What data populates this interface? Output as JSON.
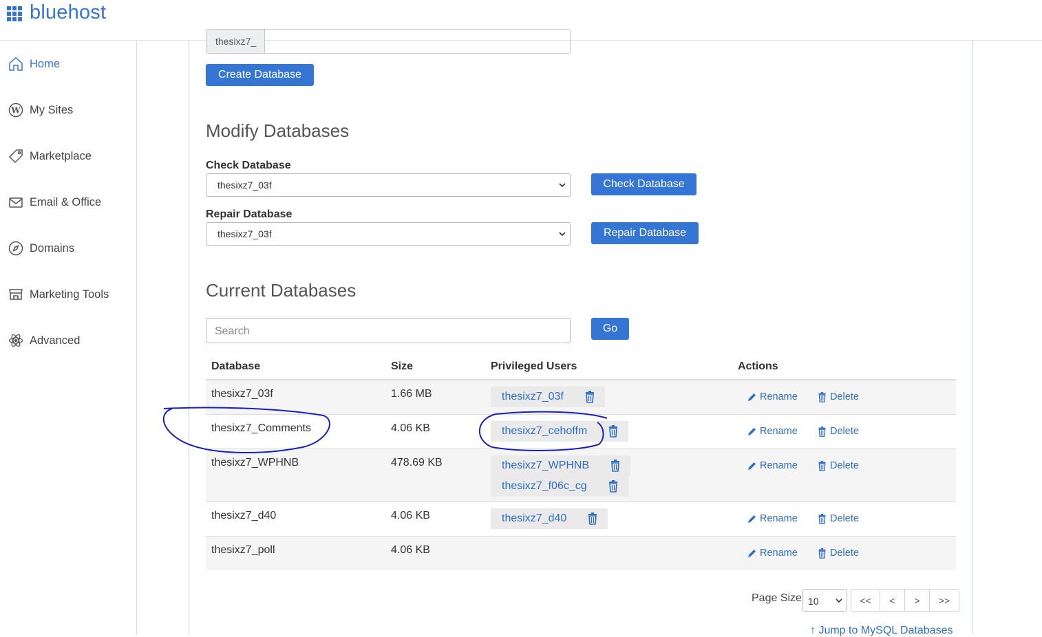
{
  "brand": {
    "name": "bluehost",
    "color": "#3575d3"
  },
  "sidebar": {
    "items": [
      {
        "label": "Home",
        "icon": "home-icon",
        "active": true
      },
      {
        "label": "My Sites",
        "icon": "wordpress-icon"
      },
      {
        "label": "Marketplace",
        "icon": "tag-icon"
      },
      {
        "label": "Email & Office",
        "icon": "envelope-icon"
      },
      {
        "label": "Domains",
        "icon": "compass-icon"
      },
      {
        "label": "Marketing Tools",
        "icon": "storefront-icon"
      },
      {
        "label": "Advanced",
        "icon": "atom-icon"
      }
    ]
  },
  "create": {
    "prefix": "thesixz7_",
    "button": "Create Database"
  },
  "modify": {
    "title": "Modify Databases",
    "check_label": "Check Database",
    "check_value": "thesixz7_03f",
    "check_button": "Check Database",
    "repair_label": "Repair Database",
    "repair_value": "thesixz7_03f",
    "repair_button": "Repair Database"
  },
  "current": {
    "title": "Current Databases",
    "search_placeholder": "Search",
    "go_button": "Go",
    "columns": [
      "Database",
      "Size",
      "Privileged Users",
      "Actions"
    ],
    "rows": [
      {
        "db": "thesixz7_03f",
        "size": "1.66 MB",
        "users": [
          "thesixz7_03f"
        ]
      },
      {
        "db": "thesixz7_Comments",
        "size": "4.06 KB",
        "users": [
          "thesixz7_cehoffm"
        ]
      },
      {
        "db": "thesixz7_WPHNB",
        "size": "478.69 KB",
        "users": [
          "thesixz7_WPHNB",
          "thesixz7_f06c_cg"
        ]
      },
      {
        "db": "thesixz7_d40",
        "size": "4.06 KB",
        "users": [
          "thesixz7_d40"
        ]
      },
      {
        "db": "thesixz7_poll",
        "size": "4.06 KB",
        "users": []
      }
    ],
    "rename_label": "Rename",
    "delete_label": "Delete"
  },
  "pagination": {
    "label": "Page Size",
    "size": "10",
    "first": "<<",
    "prev": "<",
    "next": ">",
    "last": ">>"
  },
  "jump_link": "Jump to MySQL Databases",
  "colors": {
    "accent": "#3575d3",
    "annotation": "#1a1fbf"
  }
}
